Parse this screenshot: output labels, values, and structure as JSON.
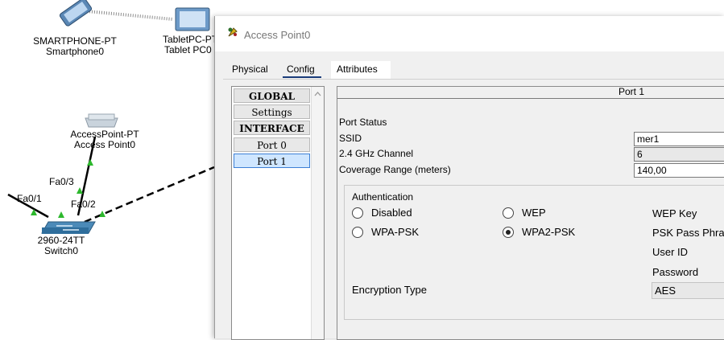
{
  "topology": {
    "devices": [
      {
        "id": "smartphone",
        "model": "SMARTPHONE-PT",
        "name": "Smartphone0"
      },
      {
        "id": "tablet",
        "model": "TabletPC-PT",
        "name": "Tablet PC0"
      },
      {
        "id": "accesspoint",
        "model": "AccessPoint-PT",
        "name": "Access Point0"
      },
      {
        "id": "switch",
        "model": "2960-24TT",
        "name": "Switch0"
      }
    ],
    "ports": {
      "fa03": "Fa0/3",
      "fa01": "Fa0/1",
      "fa02": "Fa0/2"
    },
    "colors": {
      "link_up": "#2db82d",
      "cable": "#000000",
      "wireless": "#9a9a9a"
    }
  },
  "dialog": {
    "title": "Access Point0",
    "tabs": [
      "Physical",
      "Config",
      "Attributes"
    ],
    "active_tab": "Config",
    "left_list": {
      "global_header": "GLOBAL",
      "settings": "Settings",
      "interface_header": "INTERFACE",
      "port0": "Port 0",
      "port1": "Port 1",
      "selected": "Port 1"
    },
    "panel": {
      "title": "Port 1",
      "port_status_label": "Port Status",
      "ssid_label": "SSID",
      "ssid_value": "mer1",
      "channel_label": "2.4 GHz Channel",
      "channel_value": "6",
      "coverage_label": "Coverage Range (meters)",
      "coverage_value": "140,00",
      "authentication": {
        "title": "Authentication",
        "disabled": "Disabled",
        "wep": "WEP",
        "wpa_psk": "WPA-PSK",
        "wpa2_psk": "WPA2-PSK",
        "selected": "WPA2-PSK",
        "wep_key_label": "WEP Key",
        "psk_label": "PSK Pass Phra",
        "user_id_label": "User ID",
        "password_label": "Password"
      },
      "encryption_label": "Encryption Type",
      "encryption_value": "AES"
    }
  }
}
